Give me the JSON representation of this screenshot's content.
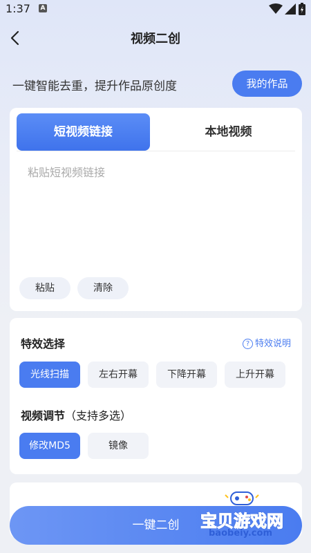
{
  "status_bar": {
    "time": "1:37",
    "notif_letter": "A"
  },
  "nav": {
    "title": "视频二创"
  },
  "header": {
    "slogan": "一键智能去重，提升作品原创度",
    "my_works_label": "我的作品"
  },
  "link_card": {
    "tabs": [
      {
        "label": "短视频链接",
        "active": true
      },
      {
        "label": "本地视频",
        "active": false
      }
    ],
    "input": {
      "value": "",
      "placeholder": "粘贴短视频链接"
    },
    "paste_label": "粘贴",
    "clear_label": "清除"
  },
  "effects": {
    "title": "特效选择",
    "help_label": "特效说明",
    "options": [
      {
        "label": "光线扫描",
        "selected": true
      },
      {
        "label": "左右开幕",
        "selected": false
      },
      {
        "label": "下降开幕",
        "selected": false
      },
      {
        "label": "上升开幕",
        "selected": false
      }
    ]
  },
  "adjust": {
    "title": "视频调节",
    "title_note": "（支持多选）",
    "options": [
      {
        "label": "修改MD5",
        "selected": true
      },
      {
        "label": "镜像",
        "selected": false
      }
    ]
  },
  "action": {
    "label": "一键二创"
  },
  "watermark": {
    "text": "宝贝游戏网",
    "domain": "baobeiy.com"
  },
  "colors": {
    "accent": "#4a7cf0",
    "chip_bg": "#f1f3f8",
    "watermark_yellow": "#ffc21a"
  }
}
